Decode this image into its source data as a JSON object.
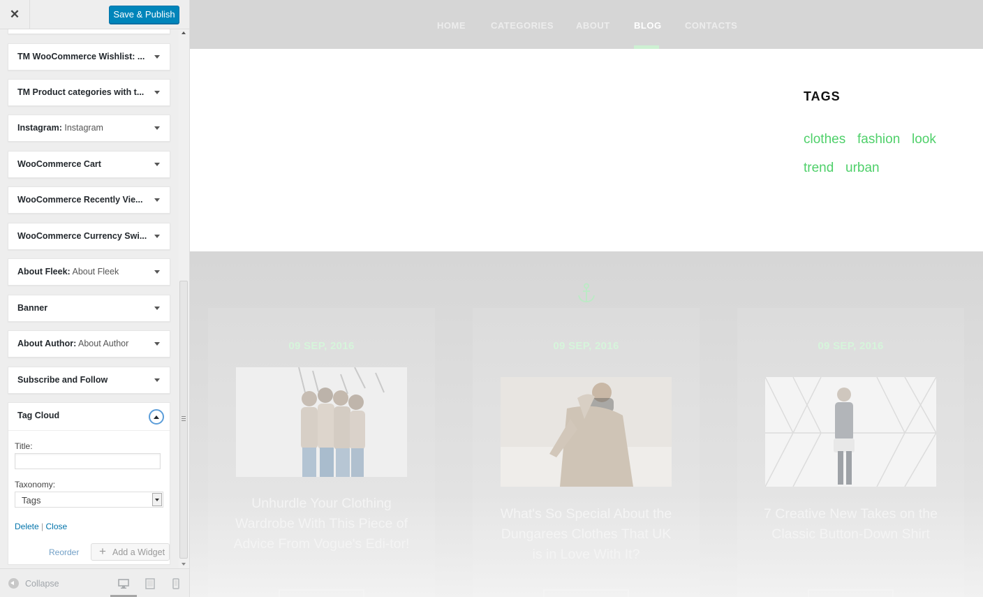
{
  "customizer": {
    "close_glyph": "✕",
    "publish_label": "Save & Publish",
    "widgets": [
      {
        "title": "TM WooCommerce Wishlist: ...",
        "subtitle": ""
      },
      {
        "title": "TM Product categories with t...",
        "subtitle": ""
      },
      {
        "title": "Instagram:",
        "subtitle": " Instagram"
      },
      {
        "title": "WooCommerce Cart",
        "subtitle": ""
      },
      {
        "title": "WooCommerce Recently Vie...",
        "subtitle": ""
      },
      {
        "title": "WooCommerce Currency Swi...",
        "subtitle": ""
      },
      {
        "title": "About Fleek:",
        "subtitle": " About Fleek"
      },
      {
        "title": "Banner",
        "subtitle": ""
      },
      {
        "title": "About Author:",
        "subtitle": " About Author"
      },
      {
        "title": "Subscribe and Follow",
        "subtitle": ""
      }
    ],
    "tag_cloud": {
      "title": "Tag Cloud",
      "title_field_label": "Title:",
      "title_field_value": "",
      "taxonomy_label": "Taxonomy:",
      "taxonomy_value": "Tags",
      "delete_label": "Delete",
      "separator": "|",
      "close_label": "Close"
    },
    "reorder_label": "Reorder",
    "add_widget_label": "Add a Widget",
    "collapse_label": "Collapse"
  },
  "site": {
    "nav": [
      "HOME",
      "CATEGORIES",
      "ABOUT",
      "BLOG",
      "CONTACTS"
    ],
    "active_nav": "BLOG",
    "tags_heading": "TAGS",
    "tags": [
      "clothes",
      "fashion",
      "look",
      "trend",
      "urban"
    ],
    "posts": [
      {
        "date": "09 SEP, 2016",
        "title": "Unhurdle Your Clothing Wardrobe With This Piece of Advice From Vogue's Edi-tor!"
      },
      {
        "date": "09 SEP, 2016",
        "title": "What's So Special About the Dungarees Clothes That UK is in Love With It?"
      },
      {
        "date": "09 SEP, 2016",
        "title": "7 Creative New Takes on the Classic Button-Down Shirt"
      }
    ]
  },
  "colors": {
    "accent": "#4fd06a",
    "publish_button": "#0085ba",
    "link": "#0073aa"
  },
  "icons": {
    "close": "close-icon",
    "dropdown": "chevron-down-icon",
    "collapse_toggle": "chevron-up-icon",
    "add": "plus-icon",
    "collapse_sidebar": "arrow-left-circle-icon",
    "preview_desktop": "desktop-icon",
    "preview_tablet": "tablet-icon",
    "preview_mobile": "mobile-icon",
    "decorative": "anchor-icon"
  }
}
